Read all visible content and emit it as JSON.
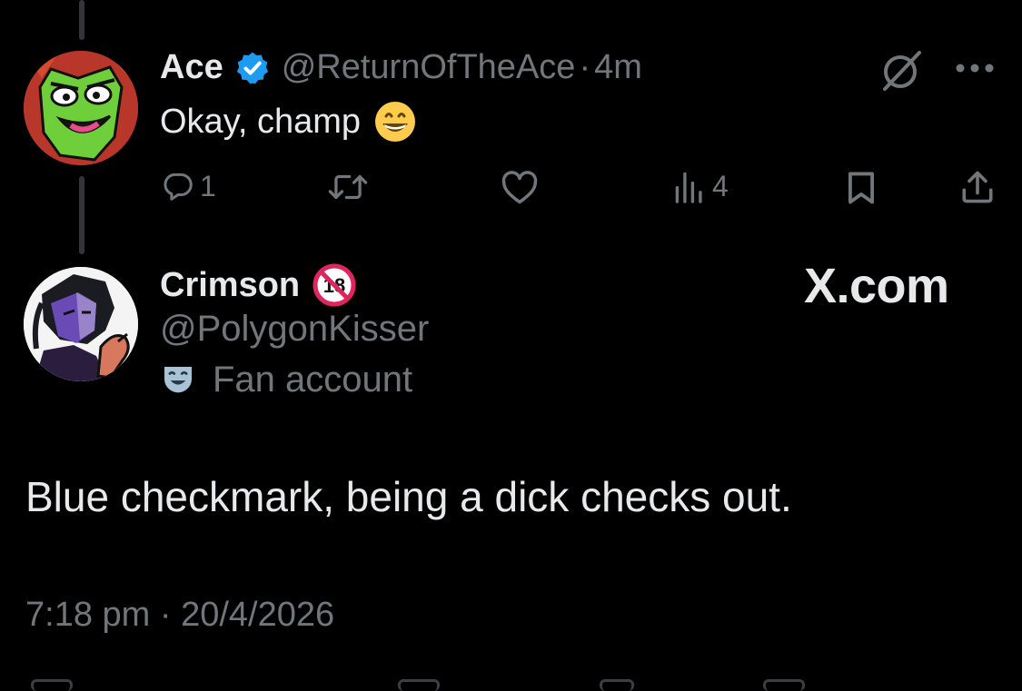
{
  "reply_tweet": {
    "author": {
      "display_name": "Ace",
      "handle": "@ReturnOfTheAce",
      "verified": true,
      "avatar_icon": "green-alien-avatar"
    },
    "separator": "·",
    "time_ago": "4m",
    "text": "Okay, champ",
    "emoji_icon": "grinning-face-emoji",
    "grok_icon": "grok-slash-icon",
    "more_icon": "more-dots-icon",
    "actions": {
      "reply_count": "1",
      "retweet_count": "",
      "like_count": "",
      "views_count": "4"
    }
  },
  "main_tweet": {
    "author": {
      "display_name": "Crimson",
      "handle": "@PolygonKisser",
      "badge_icon": "no-under-18-icon",
      "avatar_icon": "purple-character-avatar"
    },
    "label_icon": "theater-mask-icon",
    "label": "Fan account",
    "text": "Blue checkmark, being a dick checks out.",
    "timestamp": "7:18 pm · 20/4/2026"
  },
  "watermark": "X.com",
  "colors": {
    "background": "#000000",
    "primary_text": "#e7e9ea",
    "secondary_text": "#71767b",
    "verified_blue": "#1d9bf0",
    "thread_line": "#333639"
  }
}
